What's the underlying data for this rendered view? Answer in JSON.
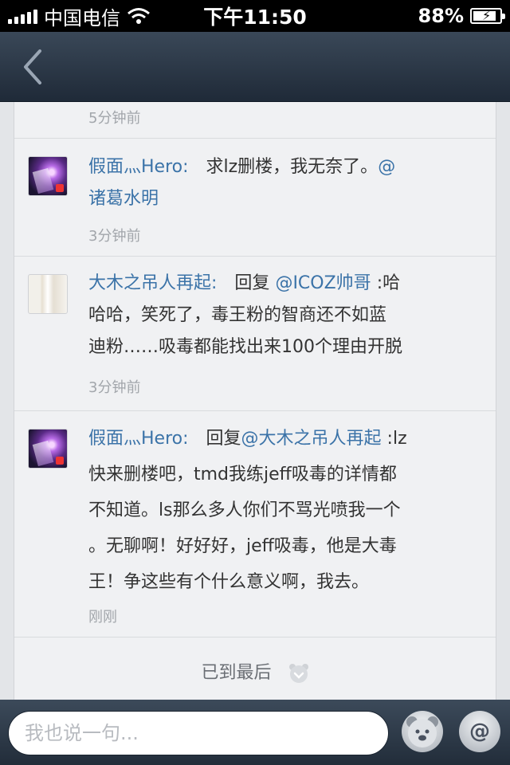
{
  "status_bar": {
    "carrier": "中国电信",
    "time": "下午11:50",
    "battery": "88%"
  },
  "nav": {
    "back_icon": "chevron-left-icon"
  },
  "comments": [
    {
      "time": "5分钟前"
    },
    {
      "avatar": "hero-avatar",
      "username": "假面灬Hero:",
      "text_line1": "求lz删楼，我无奈了。",
      "mention": "@",
      "text_line2_mention": "诸葛水明",
      "time": "3分钟前"
    },
    {
      "avatar": "wood-avatar",
      "username": "大木之吊人再起:",
      "reply_prefix": "回复",
      "mention": "@ICOZ帅哥",
      "text_after": ":哈",
      "line2": "哈哈，笑死了，毒王粉的智商还不如蓝",
      "line3": "迪粉……吸毒都能找出来100个理由开脱",
      "time": "3分钟前"
    },
    {
      "avatar": "hero-avatar",
      "username": "假面灬Hero:",
      "reply_prefix": "回复",
      "mention": "@大木之吊人再起",
      "text_after": ":lz",
      "line2": "快来删楼吧，tmd我练jeff吸毒的详情都",
      "line3": "不知道。ls那么多人你们不骂光喷我一个",
      "line4": "。无聊啊！好好好，jeff吸毒，他是大毒",
      "line5": "王！争这些有个什么意义啊，我去。",
      "time": "刚刚"
    }
  ],
  "footer": {
    "end_text": "已到最后"
  },
  "input_bar": {
    "placeholder": "我也说一句...",
    "emoji_icon": "bear-face-icon",
    "at_label": "@"
  }
}
